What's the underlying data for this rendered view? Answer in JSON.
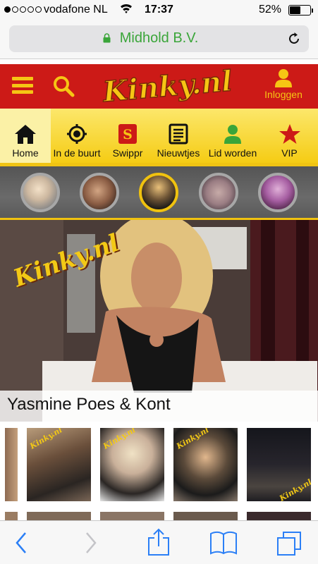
{
  "status_bar": {
    "carrier": "vodafone NL",
    "time": "17:37",
    "battery_percent_label": "52%",
    "battery_level": 0.52
  },
  "browser": {
    "url_label": "Midhold B.V."
  },
  "header": {
    "logo_text": "Kinky.nl",
    "login_label": "Inloggen"
  },
  "nav": {
    "items": [
      {
        "label": "Home",
        "icon": "home-icon"
      },
      {
        "label": "In de buurt",
        "icon": "location-icon"
      },
      {
        "label": "Swippr",
        "icon": "swippr-icon"
      },
      {
        "label": "Nieuwtjes",
        "icon": "news-icon"
      },
      {
        "label": "Lid worden",
        "icon": "user-icon"
      },
      {
        "label": "VIP",
        "icon": "star-icon"
      }
    ]
  },
  "hero": {
    "watermark": "Kinky.nl",
    "caption": "Yasmine Poes & Kont"
  },
  "thumbnails": {
    "watermark": "Kinky.nl"
  },
  "colors": {
    "header_red": "#cc1a17",
    "brand_yellow": "#f6c514",
    "url_green": "#3aa539",
    "ios_blue": "#2b7ff6"
  }
}
